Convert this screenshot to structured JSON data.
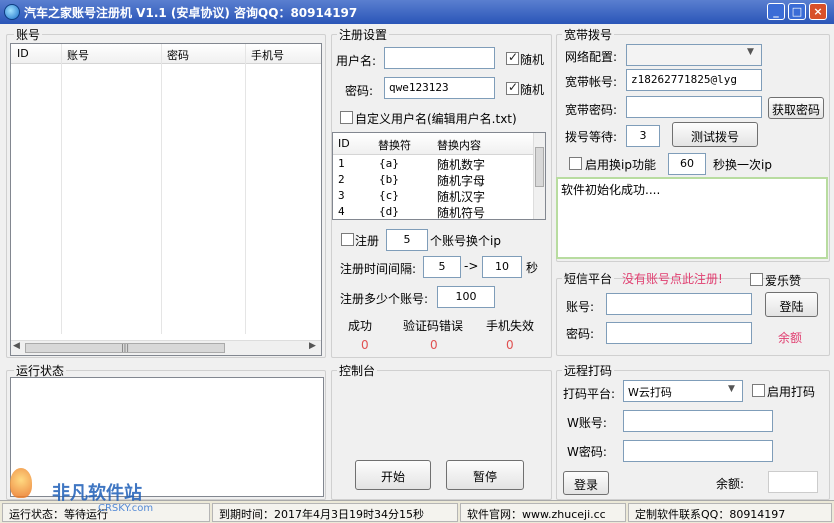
{
  "window": {
    "title": "汽车之家账号注册机 V1.1 (安卓协议) 咨询QQ：80914197",
    "min_label": "_",
    "max_label": "□",
    "close_label": "×"
  },
  "accounts": {
    "title": "账号",
    "columns": [
      "ID",
      "账号",
      "密码",
      "手机号"
    ],
    "scroll_grip": "|||"
  },
  "register": {
    "title": "注册设置",
    "username_label": "用户名:",
    "username_value": "",
    "password_label": "密码:",
    "password_value": "qwe123123",
    "random_label": "随机",
    "custom_user_label": "自定义用户名(编辑用户名.txt)",
    "table_columns": [
      "ID",
      "替换符",
      "替换内容"
    ],
    "table_rows": [
      {
        "id": "1",
        "sym": "{a}",
        "content": "随机数字"
      },
      {
        "id": "2",
        "sym": "{b}",
        "content": "随机字母"
      },
      {
        "id": "3",
        "sym": "{c}",
        "content": "随机汉字"
      },
      {
        "id": "4",
        "sym": "{d}",
        "content": "随机符号"
      }
    ],
    "register_label": "注册",
    "register_count": "5",
    "ip_suffix": "个账号换个ip",
    "interval_label": "注册时间间隔:",
    "interval_from": "5",
    "arrow": "->",
    "interval_to": "10",
    "seconds": "秒",
    "total_label": "注册多少个账号:",
    "total_value": "100",
    "stats": [
      {
        "label": "成功",
        "value": "0"
      },
      {
        "label": "验证码错误",
        "value": "0"
      },
      {
        "label": "手机失效",
        "value": "0"
      }
    ]
  },
  "broadband": {
    "title": "宽带拨号",
    "network_label": "网络配置:",
    "network_value": "",
    "account_label": "宽带帐号:",
    "account_value": "z18262771825@lyg",
    "password_label": "宽带密码:",
    "password_value": "",
    "get_password_btn": "获取密码",
    "wait_label": "拨号等待:",
    "wait_value": "3",
    "test_dial_btn": "测试拨号",
    "enable_ip_label": "启用换ip功能",
    "ip_seconds": "60",
    "ip_suffix": "秒换一次ip",
    "log_text": "软件初始化成功...."
  },
  "sms": {
    "title": "短信平台",
    "notice": "没有账号点此注册!",
    "aile_label": "爱乐赞",
    "account_label": "账号:",
    "password_label": "密码:",
    "login_btn": "登陆",
    "balance_label": "余额"
  },
  "running": {
    "title": "运行状态"
  },
  "console": {
    "title": "控制台",
    "start_btn": "开始",
    "pause_btn": "暂停"
  },
  "remote": {
    "title": "远程打码",
    "platform_label": "打码平台:",
    "platform_value": "W云打码",
    "enable_label": "启用打码",
    "account_label": "W账号:",
    "password_label": "W密码:",
    "login_btn": "登录",
    "balance_label": "余额:"
  },
  "statusbar": {
    "running": "运行状态：等待运行",
    "expire": "到期时间：2017年4月3日19时34分15秒",
    "website": "软件官网：www.zhuceji.cc",
    "contact": "定制软件联系QQ：80914197"
  },
  "watermark": {
    "text": "非凡软件站",
    "sub": "CRSKY.com"
  },
  "colors": {
    "accent": "#2a55b8",
    "red": "#e05050",
    "pink": "#e03d6f"
  }
}
